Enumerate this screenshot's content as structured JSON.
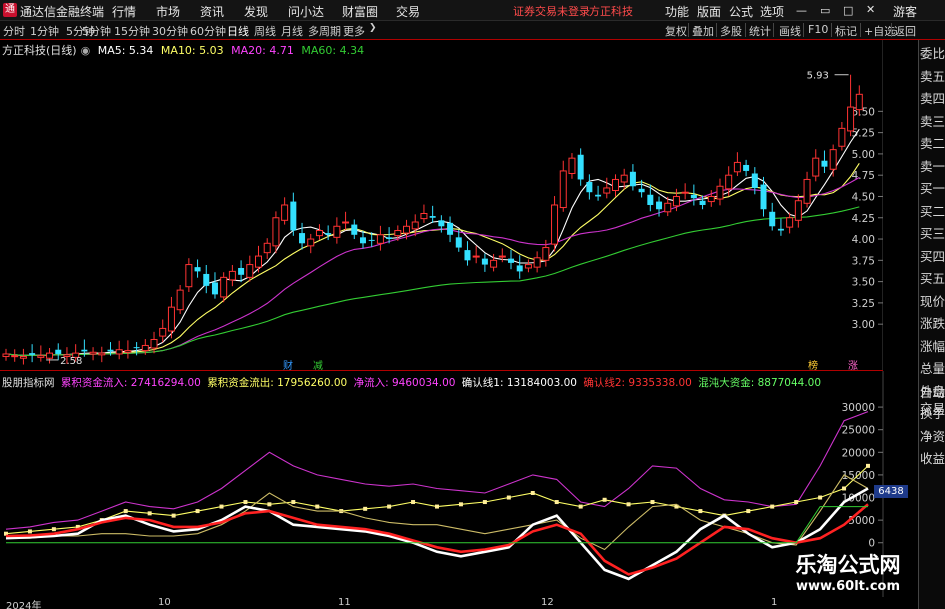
{
  "app": {
    "title": "通达信金融终端",
    "menu": [
      "行情",
      "市场",
      "资讯",
      "发现",
      "问小达",
      "财富圈",
      "交易"
    ],
    "notice": "证券交易未登录",
    "stock_title": "方正科技",
    "right_menu": [
      "功能",
      "版面",
      "公式",
      "选项"
    ],
    "user": "游客"
  },
  "periodbar": {
    "periods": [
      "分时",
      "1分钟",
      "5分钟",
      "15分钟",
      "30分钟",
      "60分钟",
      "日线",
      "周线",
      "月线",
      "多周期",
      "更多"
    ],
    "active": "日线",
    "tools": [
      "复权",
      "叠加",
      "多股",
      "统计",
      "画线",
      "F10",
      "标记",
      "+自选",
      "返回"
    ]
  },
  "main_legend": {
    "name": "方正科技(日线)",
    "ma5": "MA5: 5.34",
    "ma10": "MA10: 5.03",
    "ma20": "MA20: 4.71",
    "ma60": "MA60: 4.34"
  },
  "right_panel": [
    "委比",
    "卖五",
    "卖四",
    "卖三",
    "卖二",
    "卖一",
    "买一",
    "买二",
    "买三",
    "买四",
    "买五",
    "现价",
    "涨跌",
    "涨幅",
    "总量",
    "外盘",
    "换手",
    "净资",
    "收益",
    "自动",
    "交易"
  ],
  "price_marks": {
    "high_label": "5.93",
    "low_label": "2.58",
    "event_labels": [
      "财",
      "减",
      "榜",
      "涨"
    ]
  },
  "indicator": {
    "name": "股朋指标网",
    "items": [
      {
        "label": "累积资金流入: 27416294.00",
        "color": "#ff44ff"
      },
      {
        "label": "累积资金流出: 17956260.00",
        "color": "#ffff66"
      },
      {
        "label": "净流入: 9460034.00",
        "color": "#ff44ff"
      },
      {
        "label": "确认线1: 13184003.00",
        "color": "#ffffff"
      },
      {
        "label": "确认线2: 9335338.00",
        "color": "#ff3333"
      },
      {
        "label": "混沌大资金: 8877044.00",
        "color": "#66ff66"
      }
    ],
    "current_value": "6438"
  },
  "time_axis": [
    "2024年",
    "10",
    "11",
    "12",
    "1"
  ],
  "watermark": {
    "line1": "乐淘公式网",
    "line2": "www.60lt.com"
  },
  "chart_data": [
    {
      "type": "candlestick",
      "title": "方正科技(日线)",
      "y_ticks": [
        3.0,
        3.25,
        3.5,
        3.75,
        4.0,
        4.25,
        4.5,
        4.75,
        5.0,
        5.25,
        5.5
      ],
      "ylim": [
        2.45,
        6.15
      ],
      "high": 5.93,
      "low": 2.58,
      "close_series": [
        2.65,
        2.63,
        2.62,
        2.64,
        2.63,
        2.66,
        2.65,
        2.64,
        2.66,
        2.68,
        2.67,
        2.66,
        2.68,
        2.7,
        2.69,
        2.72,
        2.75,
        2.82,
        2.95,
        3.2,
        3.4,
        3.7,
        3.62,
        3.45,
        3.35,
        3.55,
        3.62,
        3.58,
        3.7,
        3.8,
        3.95,
        4.25,
        4.4,
        4.1,
        3.95,
        4.0,
        4.1,
        4.05,
        4.15,
        4.2,
        4.05,
        3.95,
        3.98,
        4.05,
        4.0,
        4.1,
        4.15,
        4.2,
        4.3,
        4.25,
        4.15,
        4.05,
        3.9,
        3.75,
        3.8,
        3.7,
        3.75,
        3.8,
        3.72,
        3.62,
        3.7,
        3.78,
        3.9,
        4.4,
        4.8,
        4.95,
        4.7,
        4.55,
        4.5,
        4.6,
        4.7,
        4.75,
        4.62,
        4.55,
        4.4,
        4.35,
        4.42,
        4.5,
        4.55,
        4.48,
        4.4,
        4.5,
        4.62,
        4.75,
        4.9,
        4.8,
        4.6,
        4.35,
        4.15,
        4.1,
        4.25,
        4.45,
        4.7,
        4.95,
        4.85,
        5.05,
        5.3,
        5.55,
        5.7
      ],
      "ma": [
        {
          "name": "MA5",
          "value": 5.34,
          "color": "#ffffff"
        },
        {
          "name": "MA10",
          "value": 5.03,
          "color": "#ffff66"
        },
        {
          "name": "MA20",
          "value": 4.71,
          "color": "#ff44ff"
        },
        {
          "name": "MA60",
          "value": 4.34,
          "color": "#33cc33"
        }
      ]
    },
    {
      "type": "line",
      "title": "股朋指标网",
      "y_ticks": [
        0,
        5000,
        10000,
        15000,
        20000,
        25000,
        30000
      ],
      "ylim": [
        -12000,
        34000
      ],
      "series": [
        {
          "name": "累积资金流入",
          "color": "#cc33cc",
          "values": [
            3000,
            3500,
            4500,
            5000,
            7000,
            9000,
            8000,
            7500,
            9000,
            12000,
            16000,
            20000,
            17000,
            15000,
            14000,
            13000,
            12500,
            13000,
            12000,
            11500,
            11000,
            13000,
            15000,
            14000,
            9000,
            8000,
            12000,
            17000,
            16500,
            12000,
            9500,
            9000,
            8000,
            8500,
            17000,
            27000,
            29000
          ]
        },
        {
          "name": "累积资金流出",
          "color": "#ffff66",
          "values": [
            2000,
            2500,
            3000,
            3500,
            5000,
            7000,
            6500,
            6000,
            7000,
            8000,
            9000,
            8500,
            9000,
            8000,
            7000,
            7500,
            8000,
            9000,
            8000,
            8500,
            9000,
            10000,
            11000,
            9000,
            8000,
            9500,
            8500,
            9000,
            8000,
            7000,
            6000,
            7000,
            8000,
            9000,
            10000,
            12000,
            17000
          ]
        },
        {
          "name": "净流入",
          "color": "#ccbb66",
          "values": [
            1000,
            1000,
            1500,
            1500,
            2000,
            2000,
            1500,
            1500,
            2000,
            4000,
            7000,
            11000,
            8000,
            7000,
            7000,
            5500,
            4500,
            4000,
            4000,
            3000,
            2000,
            3000,
            4000,
            5000,
            1000,
            -1500,
            3500,
            8000,
            8500,
            5000,
            3500,
            2000,
            0,
            -500,
            7000,
            15000,
            12000
          ]
        },
        {
          "name": "确认线1",
          "color": "#ffffff",
          "values": [
            1000,
            1200,
            1500,
            2000,
            5000,
            6000,
            4000,
            2500,
            3000,
            5000,
            8000,
            7000,
            4000,
            3500,
            3000,
            2500,
            1500,
            0,
            -2000,
            -3000,
            -2000,
            -1000,
            4000,
            6000,
            0,
            -6000,
            -8000,
            -5000,
            -2000,
            3000,
            6000,
            2000,
            -1000,
            0,
            3000,
            9000,
            12000
          ]
        },
        {
          "name": "确认线2",
          "color": "#ff2222",
          "values": [
            1500,
            1600,
            2000,
            3000,
            4500,
            5500,
            5000,
            3500,
            3500,
            4500,
            6500,
            7000,
            5500,
            4000,
            3500,
            3000,
            2000,
            500,
            -1000,
            -2000,
            -1500,
            -500,
            2500,
            4000,
            2000,
            -4000,
            -7000,
            -5500,
            -3500,
            0,
            3500,
            3000,
            1000,
            0,
            1000,
            4000,
            8500
          ]
        },
        {
          "name": "混沌大资金",
          "color": "#33cc33",
          "values": [
            0,
            0,
            0,
            0,
            0,
            0,
            0,
            0,
            0,
            0,
            0,
            0,
            0,
            0,
            0,
            0,
            0,
            0,
            0,
            0,
            0,
            0,
            0,
            0,
            0,
            0,
            0,
            0,
            0,
            0,
            0,
            0,
            0,
            0,
            8000,
            8000,
            8000
          ]
        }
      ]
    }
  ]
}
